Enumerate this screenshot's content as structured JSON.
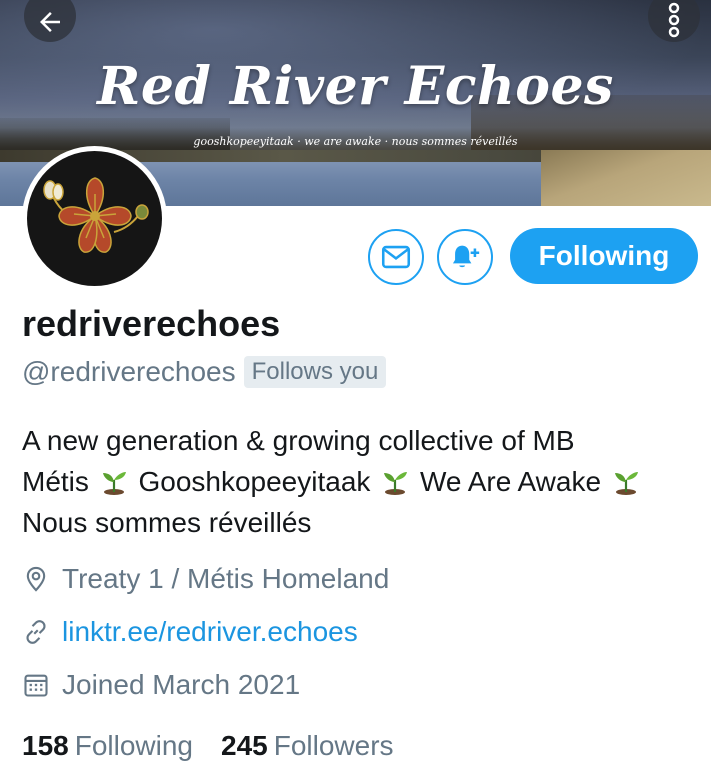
{
  "banner": {
    "title": "Red River Echoes",
    "subtitle": "gooshkopeeyitaak · we are awake · nous sommes réveillés"
  },
  "nav": {
    "back_icon": "arrow-left-icon",
    "more_icon": "more-vertical-icon"
  },
  "profile": {
    "display_name": "redriverechoes",
    "handle": "@redriverechoes",
    "follows_you": "Follows you",
    "bio": {
      "line1": "A new generation & growing collective of MB",
      "line2_a": "Métis",
      "line2_b": "Gooshkopeeyitaak",
      "line2_c": "We Are Awake",
      "line3": "Nous sommes réveillés"
    },
    "location": "Treaty 1 / Métis Homeland",
    "link": "linktr.ee/redriver.echoes",
    "joined": "Joined March 2021"
  },
  "actions": {
    "following_label": "Following",
    "message_icon": "envelope-icon",
    "notify_icon": "bell-plus-icon"
  },
  "stats": {
    "following_count": "158",
    "following_label": "Following",
    "followers_count": "245",
    "followers_label": "Followers"
  },
  "colors": {
    "accent": "#1da1f2",
    "link": "#1b95e0",
    "secondary_text": "#657786",
    "primary_text": "#14171a",
    "avatar_flower": "#b5492a"
  }
}
